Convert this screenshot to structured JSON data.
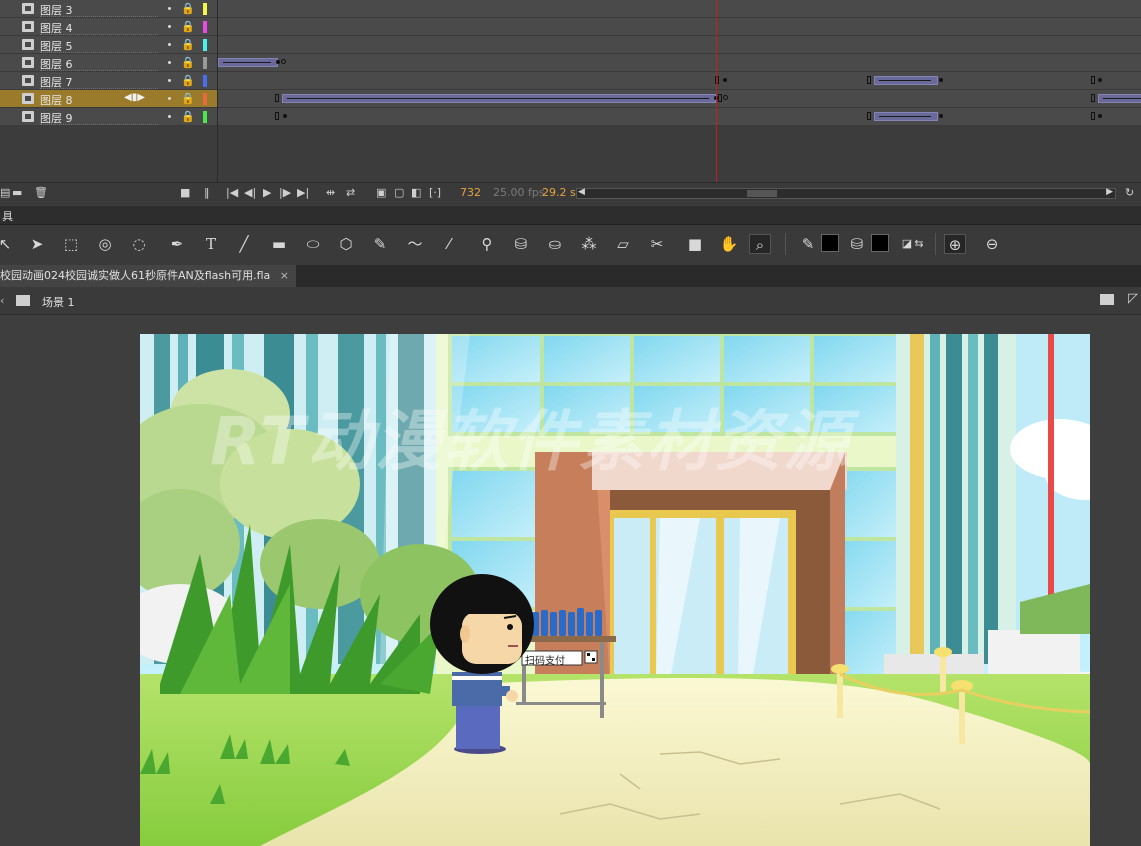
{
  "timeline": {
    "layers": [
      {
        "name": "图层 3",
        "color": "#f5f54a",
        "selected": false
      },
      {
        "name": "图层 4",
        "color": "#e84ae8",
        "selected": false
      },
      {
        "name": "图层 5",
        "color": "#4af0f0",
        "selected": false
      },
      {
        "name": "图层 6",
        "color": "#9a9a9a",
        "selected": false
      },
      {
        "name": "图层 7",
        "color": "#4a6ef0",
        "selected": false
      },
      {
        "name": "图层 8",
        "color": "#e86a3a",
        "selected": true
      },
      {
        "name": "图层 9",
        "color": "#4ae84a",
        "selected": false
      }
    ],
    "current_frame": "732",
    "fps": "25.00 fps",
    "elapsed": "29.2 s"
  },
  "tools_tab_label": "具",
  "document": {
    "tab_title": "校园动画024校园诚实做人61秒原件AN及flash可用.fla",
    "close_glyph": "×",
    "scene_label": "场景 1"
  },
  "stage": {
    "watermark": "RT动漫软件素材资源",
    "sign_text": "扫码支付"
  },
  "colors": {
    "accent_selected_layer": "#9a7b2c",
    "playhead": "#c02020",
    "frame_counter": "#e8a23a"
  }
}
